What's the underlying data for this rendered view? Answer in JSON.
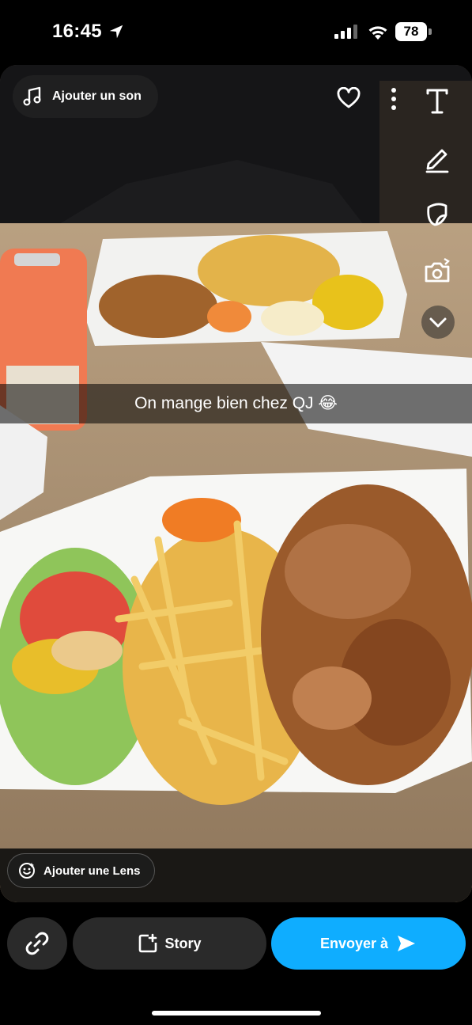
{
  "status_bar": {
    "time": "16:45",
    "battery": "78"
  },
  "photo": {
    "add_sound_label": "Ajouter un son",
    "caption": "On mange bien chez QJ 😂",
    "add_lens_label": "Ajouter une Lens"
  },
  "bottom_bar": {
    "story_label": "Story",
    "send_label": "Envoyer à"
  },
  "icons": {
    "top_left": "music-note-icon",
    "top_right": [
      "heart-icon",
      "more-icon"
    ],
    "tools": [
      "text-tool-icon",
      "pencil-icon",
      "sticker-icon",
      "camera-flip-icon",
      "chevron-down-icon"
    ],
    "bottom": [
      "link-icon",
      "story-add-icon",
      "send-arrow-icon"
    ]
  },
  "colors": {
    "send_button": "#0fadff",
    "pill_dark": "#2a2a2a"
  }
}
